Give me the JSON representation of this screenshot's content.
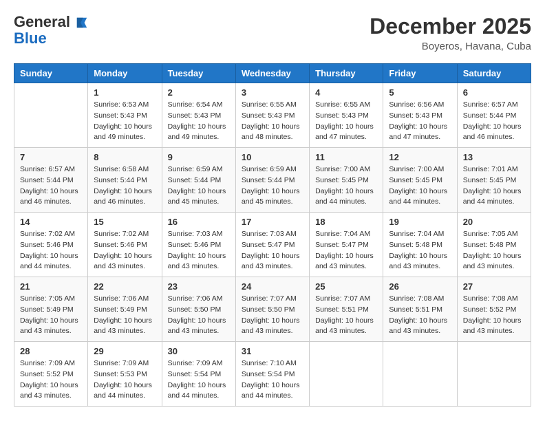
{
  "header": {
    "logo_general": "General",
    "logo_blue": "Blue",
    "month_title": "December 2025",
    "location": "Boyeros, Havana, Cuba"
  },
  "weekdays": [
    "Sunday",
    "Monday",
    "Tuesday",
    "Wednesday",
    "Thursday",
    "Friday",
    "Saturday"
  ],
  "weeks": [
    [
      {
        "day": "",
        "info": ""
      },
      {
        "day": "1",
        "info": "Sunrise: 6:53 AM\nSunset: 5:43 PM\nDaylight: 10 hours\nand 49 minutes."
      },
      {
        "day": "2",
        "info": "Sunrise: 6:54 AM\nSunset: 5:43 PM\nDaylight: 10 hours\nand 49 minutes."
      },
      {
        "day": "3",
        "info": "Sunrise: 6:55 AM\nSunset: 5:43 PM\nDaylight: 10 hours\nand 48 minutes."
      },
      {
        "day": "4",
        "info": "Sunrise: 6:55 AM\nSunset: 5:43 PM\nDaylight: 10 hours\nand 47 minutes."
      },
      {
        "day": "5",
        "info": "Sunrise: 6:56 AM\nSunset: 5:43 PM\nDaylight: 10 hours\nand 47 minutes."
      },
      {
        "day": "6",
        "info": "Sunrise: 6:57 AM\nSunset: 5:44 PM\nDaylight: 10 hours\nand 46 minutes."
      }
    ],
    [
      {
        "day": "7",
        "info": "Sunrise: 6:57 AM\nSunset: 5:44 PM\nDaylight: 10 hours\nand 46 minutes."
      },
      {
        "day": "8",
        "info": "Sunrise: 6:58 AM\nSunset: 5:44 PM\nDaylight: 10 hours\nand 46 minutes."
      },
      {
        "day": "9",
        "info": "Sunrise: 6:59 AM\nSunset: 5:44 PM\nDaylight: 10 hours\nand 45 minutes."
      },
      {
        "day": "10",
        "info": "Sunrise: 6:59 AM\nSunset: 5:44 PM\nDaylight: 10 hours\nand 45 minutes."
      },
      {
        "day": "11",
        "info": "Sunrise: 7:00 AM\nSunset: 5:45 PM\nDaylight: 10 hours\nand 44 minutes."
      },
      {
        "day": "12",
        "info": "Sunrise: 7:00 AM\nSunset: 5:45 PM\nDaylight: 10 hours\nand 44 minutes."
      },
      {
        "day": "13",
        "info": "Sunrise: 7:01 AM\nSunset: 5:45 PM\nDaylight: 10 hours\nand 44 minutes."
      }
    ],
    [
      {
        "day": "14",
        "info": "Sunrise: 7:02 AM\nSunset: 5:46 PM\nDaylight: 10 hours\nand 44 minutes."
      },
      {
        "day": "15",
        "info": "Sunrise: 7:02 AM\nSunset: 5:46 PM\nDaylight: 10 hours\nand 43 minutes."
      },
      {
        "day": "16",
        "info": "Sunrise: 7:03 AM\nSunset: 5:46 PM\nDaylight: 10 hours\nand 43 minutes."
      },
      {
        "day": "17",
        "info": "Sunrise: 7:03 AM\nSunset: 5:47 PM\nDaylight: 10 hours\nand 43 minutes."
      },
      {
        "day": "18",
        "info": "Sunrise: 7:04 AM\nSunset: 5:47 PM\nDaylight: 10 hours\nand 43 minutes."
      },
      {
        "day": "19",
        "info": "Sunrise: 7:04 AM\nSunset: 5:48 PM\nDaylight: 10 hours\nand 43 minutes."
      },
      {
        "day": "20",
        "info": "Sunrise: 7:05 AM\nSunset: 5:48 PM\nDaylight: 10 hours\nand 43 minutes."
      }
    ],
    [
      {
        "day": "21",
        "info": "Sunrise: 7:05 AM\nSunset: 5:49 PM\nDaylight: 10 hours\nand 43 minutes."
      },
      {
        "day": "22",
        "info": "Sunrise: 7:06 AM\nSunset: 5:49 PM\nDaylight: 10 hours\nand 43 minutes."
      },
      {
        "day": "23",
        "info": "Sunrise: 7:06 AM\nSunset: 5:50 PM\nDaylight: 10 hours\nand 43 minutes."
      },
      {
        "day": "24",
        "info": "Sunrise: 7:07 AM\nSunset: 5:50 PM\nDaylight: 10 hours\nand 43 minutes."
      },
      {
        "day": "25",
        "info": "Sunrise: 7:07 AM\nSunset: 5:51 PM\nDaylight: 10 hours\nand 43 minutes."
      },
      {
        "day": "26",
        "info": "Sunrise: 7:08 AM\nSunset: 5:51 PM\nDaylight: 10 hours\nand 43 minutes."
      },
      {
        "day": "27",
        "info": "Sunrise: 7:08 AM\nSunset: 5:52 PM\nDaylight: 10 hours\nand 43 minutes."
      }
    ],
    [
      {
        "day": "28",
        "info": "Sunrise: 7:09 AM\nSunset: 5:52 PM\nDaylight: 10 hours\nand 43 minutes."
      },
      {
        "day": "29",
        "info": "Sunrise: 7:09 AM\nSunset: 5:53 PM\nDaylight: 10 hours\nand 44 minutes."
      },
      {
        "day": "30",
        "info": "Sunrise: 7:09 AM\nSunset: 5:54 PM\nDaylight: 10 hours\nand 44 minutes."
      },
      {
        "day": "31",
        "info": "Sunrise: 7:10 AM\nSunset: 5:54 PM\nDaylight: 10 hours\nand 44 minutes."
      },
      {
        "day": "",
        "info": ""
      },
      {
        "day": "",
        "info": ""
      },
      {
        "day": "",
        "info": ""
      }
    ]
  ]
}
